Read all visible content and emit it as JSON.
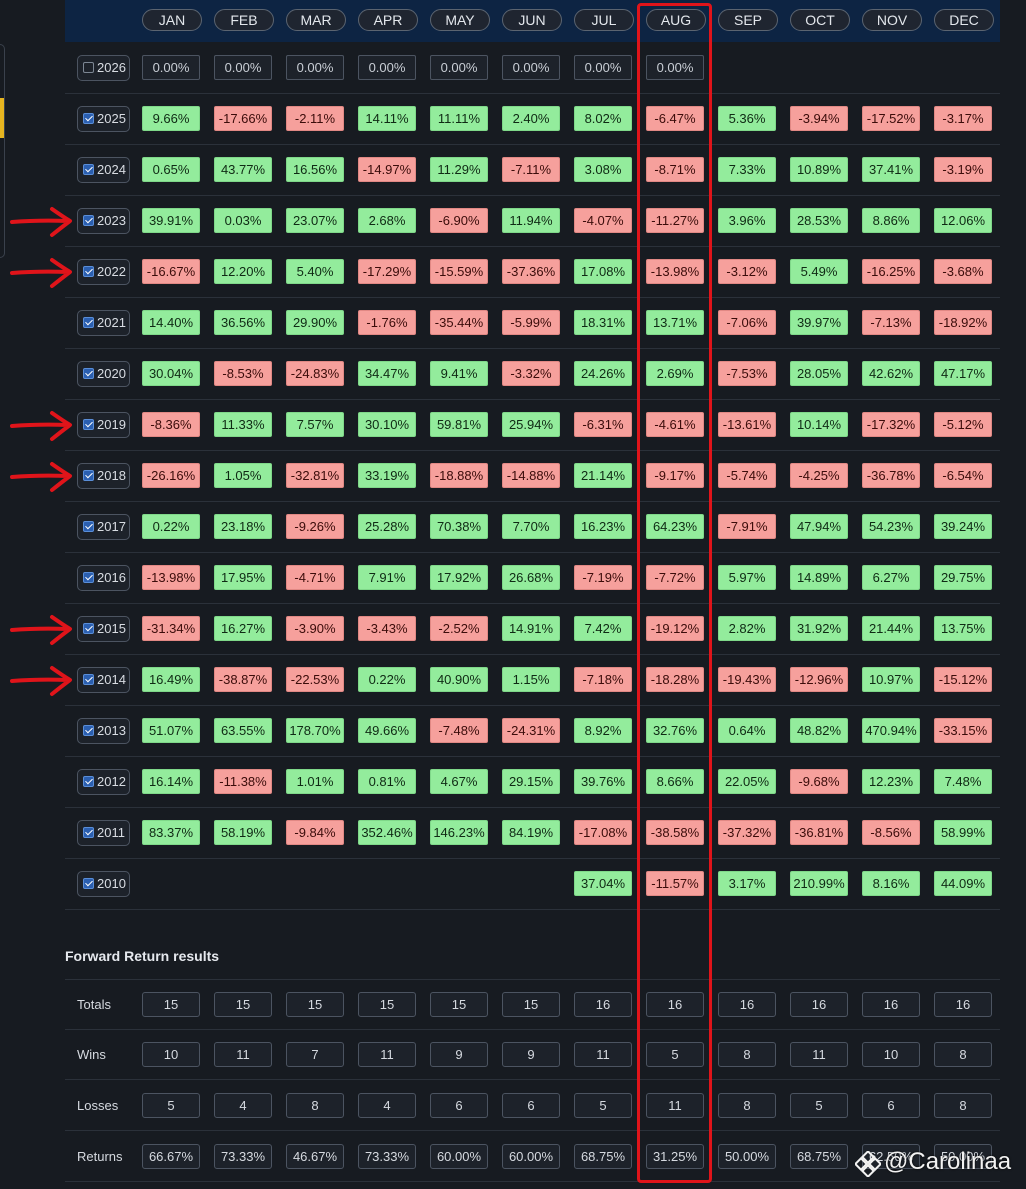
{
  "months": [
    "JAN",
    "FEB",
    "MAR",
    "APR",
    "MAY",
    "JUN",
    "JUL",
    "AUG",
    "SEP",
    "OCT",
    "NOV",
    "DEC"
  ],
  "years": [
    {
      "year": "2026",
      "checked": false,
      "values": [
        "0.00%",
        "0.00%",
        "0.00%",
        "0.00%",
        "0.00%",
        "0.00%",
        "0.00%",
        "0.00%",
        "",
        "",
        "",
        ""
      ]
    },
    {
      "year": "2025",
      "checked": true,
      "values": [
        "9.66%",
        "-17.66%",
        "-2.11%",
        "14.11%",
        "11.11%",
        "2.40%",
        "8.02%",
        "-6.47%",
        "5.36%",
        "-3.94%",
        "-17.52%",
        "-3.17%"
      ]
    },
    {
      "year": "2024",
      "checked": true,
      "values": [
        "0.65%",
        "43.77%",
        "16.56%",
        "-14.97%",
        "11.29%",
        "-7.11%",
        "3.08%",
        "-8.71%",
        "7.33%",
        "10.89%",
        "37.41%",
        "-3.19%"
      ]
    },
    {
      "year": "2023",
      "checked": true,
      "values": [
        "39.91%",
        "0.03%",
        "23.07%",
        "2.68%",
        "-6.90%",
        "11.94%",
        "-4.07%",
        "-11.27%",
        "3.96%",
        "28.53%",
        "8.86%",
        "12.06%"
      ]
    },
    {
      "year": "2022",
      "checked": true,
      "values": [
        "-16.67%",
        "12.20%",
        "5.40%",
        "-17.29%",
        "-15.59%",
        "-37.36%",
        "17.08%",
        "-13.98%",
        "-3.12%",
        "5.49%",
        "-16.25%",
        "-3.68%"
      ]
    },
    {
      "year": "2021",
      "checked": true,
      "values": [
        "14.40%",
        "36.56%",
        "29.90%",
        "-1.76%",
        "-35.44%",
        "-5.99%",
        "18.31%",
        "13.71%",
        "-7.06%",
        "39.97%",
        "-7.13%",
        "-18.92%"
      ]
    },
    {
      "year": "2020",
      "checked": true,
      "values": [
        "30.04%",
        "-8.53%",
        "-24.83%",
        "34.47%",
        "9.41%",
        "-3.32%",
        "24.26%",
        "2.69%",
        "-7.53%",
        "28.05%",
        "42.62%",
        "47.17%"
      ]
    },
    {
      "year": "2019",
      "checked": true,
      "values": [
        "-8.36%",
        "11.33%",
        "7.57%",
        "30.10%",
        "59.81%",
        "25.94%",
        "-6.31%",
        "-4.61%",
        "-13.61%",
        "10.14%",
        "-17.32%",
        "-5.12%"
      ]
    },
    {
      "year": "2018",
      "checked": true,
      "values": [
        "-26.16%",
        "1.05%",
        "-32.81%",
        "33.19%",
        "-18.88%",
        "-14.88%",
        "21.14%",
        "-9.17%",
        "-5.74%",
        "-4.25%",
        "-36.78%",
        "-6.54%"
      ]
    },
    {
      "year": "2017",
      "checked": true,
      "values": [
        "0.22%",
        "23.18%",
        "-9.26%",
        "25.28%",
        "70.38%",
        "7.70%",
        "16.23%",
        "64.23%",
        "-7.91%",
        "47.94%",
        "54.23%",
        "39.24%"
      ]
    },
    {
      "year": "2016",
      "checked": true,
      "values": [
        "-13.98%",
        "17.95%",
        "-4.71%",
        "7.91%",
        "17.92%",
        "26.68%",
        "-7.19%",
        "-7.72%",
        "5.97%",
        "14.89%",
        "6.27%",
        "29.75%"
      ]
    },
    {
      "year": "2015",
      "checked": true,
      "values": [
        "-31.34%",
        "16.27%",
        "-3.90%",
        "-3.43%",
        "-2.52%",
        "14.91%",
        "7.42%",
        "-19.12%",
        "2.82%",
        "31.92%",
        "21.44%",
        "13.75%"
      ]
    },
    {
      "year": "2014",
      "checked": true,
      "values": [
        "16.49%",
        "-38.87%",
        "-22.53%",
        "0.22%",
        "40.90%",
        "1.15%",
        "-7.18%",
        "-18.28%",
        "-19.43%",
        "-12.96%",
        "10.97%",
        "-15.12%"
      ]
    },
    {
      "year": "2013",
      "checked": true,
      "values": [
        "51.07%",
        "63.55%",
        "178.70%",
        "49.66%",
        "-7.48%",
        "-24.31%",
        "8.92%",
        "32.76%",
        "0.64%",
        "48.82%",
        "470.94%",
        "-33.15%"
      ]
    },
    {
      "year": "2012",
      "checked": true,
      "values": [
        "16.14%",
        "-11.38%",
        "1.01%",
        "0.81%",
        "4.67%",
        "29.15%",
        "39.76%",
        "8.66%",
        "22.05%",
        "-9.68%",
        "12.23%",
        "7.48%"
      ]
    },
    {
      "year": "2011",
      "checked": true,
      "values": [
        "83.37%",
        "58.19%",
        "-9.84%",
        "352.46%",
        "146.23%",
        "84.19%",
        "-17.08%",
        "-38.58%",
        "-37.32%",
        "-36.81%",
        "-8.56%",
        "58.99%"
      ]
    },
    {
      "year": "2010",
      "checked": true,
      "values": [
        "",
        "",
        "",
        "",
        "",
        "",
        "37.04%",
        "-11.57%",
        "3.17%",
        "210.99%",
        "8.16%",
        "44.09%"
      ]
    }
  ],
  "forward": {
    "title": "Forward Return results",
    "rows": [
      {
        "label": "Totals",
        "values": [
          "15",
          "15",
          "15",
          "15",
          "15",
          "15",
          "16",
          "16",
          "16",
          "16",
          "16",
          "16"
        ]
      },
      {
        "label": "Wins",
        "values": [
          "10",
          "11",
          "7",
          "11",
          "9",
          "9",
          "11",
          "5",
          "8",
          "11",
          "10",
          "8"
        ]
      },
      {
        "label": "Losses",
        "values": [
          "5",
          "4",
          "8",
          "4",
          "6",
          "6",
          "5",
          "11",
          "8",
          "5",
          "6",
          "8"
        ]
      },
      {
        "label": "Returns",
        "values": [
          "66.67%",
          "73.33%",
          "46.67%",
          "73.33%",
          "60.00%",
          "60.00%",
          "68.75%",
          "31.25%",
          "50.00%",
          "68.75%",
          "62.50%",
          "50.00%"
        ]
      }
    ]
  },
  "annotations": {
    "arrow_years": [
      "2023",
      "2022",
      "2019",
      "2018",
      "2015",
      "2014"
    ],
    "highlighted_month": "AUG",
    "color": "#e0141a"
  },
  "watermark": "@Carolinaa",
  "watermark_icon": "binance-logo-icon",
  "colors": {
    "positive": "#93ec9c",
    "negative": "#f6a09c",
    "header": "#0d2443",
    "background": "#171b21"
  }
}
